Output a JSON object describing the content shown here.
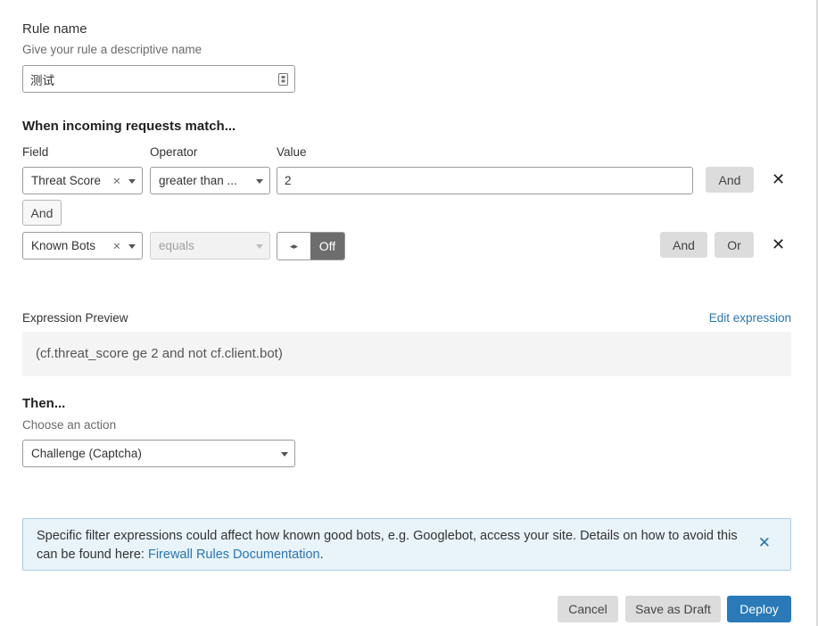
{
  "rule_name": {
    "label": "Rule name",
    "description": "Give your rule a descriptive name",
    "value": "测试",
    "field_icon": "password-manager-icon"
  },
  "match": {
    "heading": "When incoming requests match...",
    "columns": {
      "field": "Field",
      "operator": "Operator",
      "value": "Value"
    },
    "condition1": {
      "field": "Threat Score",
      "field_clear": "×",
      "operator": "greater than ...",
      "value": "2",
      "and_button": "And",
      "remove": "✕"
    },
    "join_label": "And",
    "condition2": {
      "field": "Known Bots",
      "field_clear": "×",
      "operator": "equals",
      "toggle_icon": "◂▸",
      "toggle_state": "Off",
      "and_button": "And",
      "or_button": "Or",
      "remove": "✕"
    }
  },
  "expression": {
    "label": "Expression Preview",
    "edit_link": "Edit expression",
    "text": "(cf.threat_score ge 2 and not cf.client.bot)"
  },
  "then": {
    "heading": "Then...",
    "description": "Choose an action",
    "action": "Challenge (Captcha)"
  },
  "alert": {
    "text": "Specific filter expressions could affect how known good bots, e.g. Googlebot, access your site. Details on how to avoid this can be found here: ",
    "link": "Firewall Rules Documentation",
    "suffix": ".",
    "close": "✕"
  },
  "footer": {
    "cancel": "Cancel",
    "save_draft": "Save as Draft",
    "deploy": "Deploy"
  },
  "colors": {
    "primary": "#2a7ab8",
    "link": "#2a75b3",
    "alert_bg": "#e8f3fa"
  }
}
